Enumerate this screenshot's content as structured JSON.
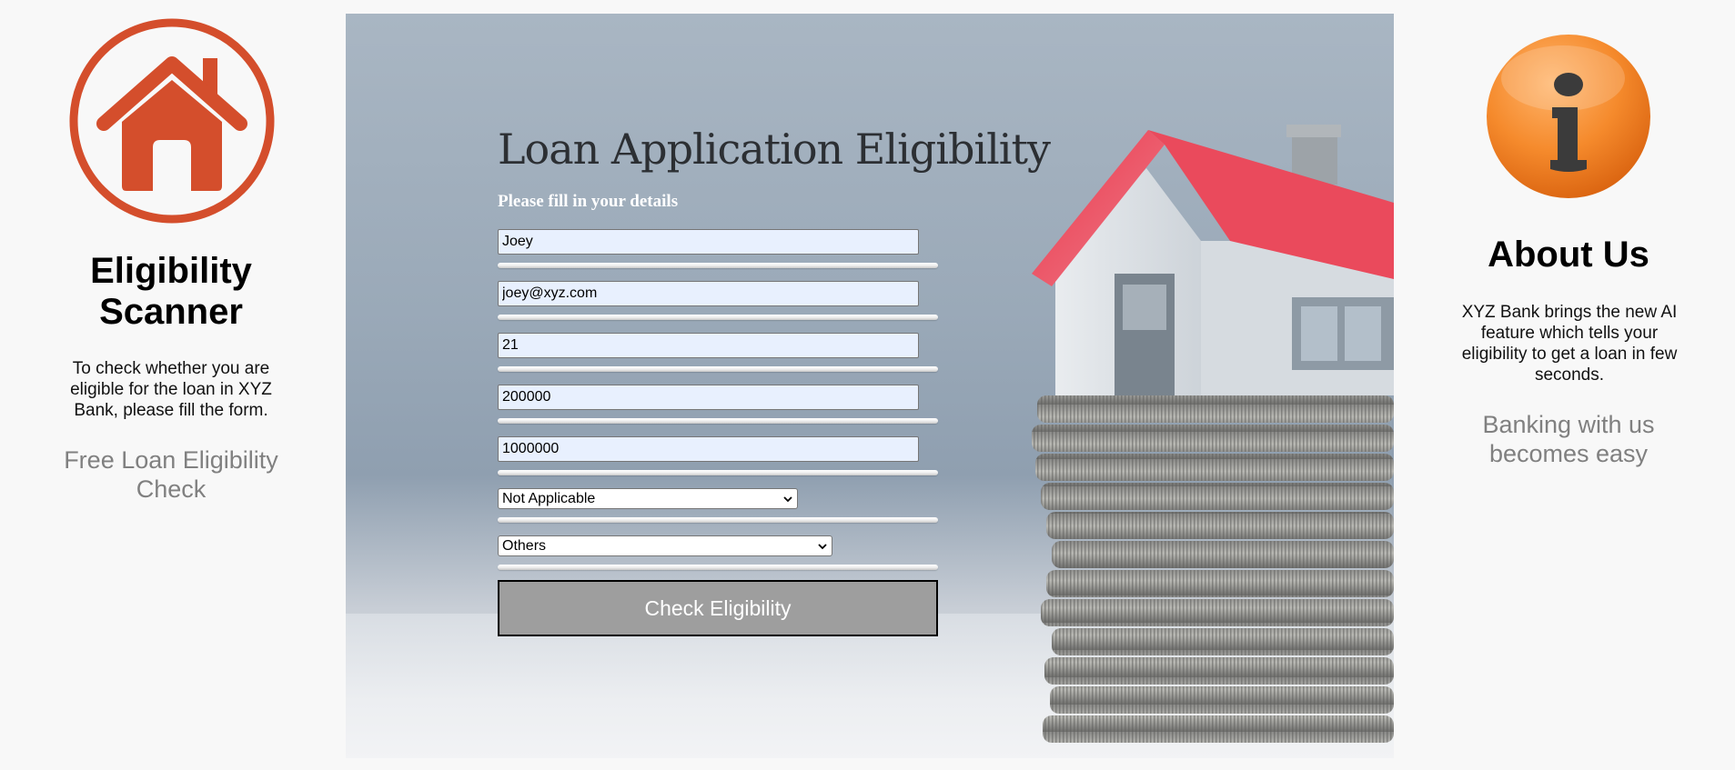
{
  "left": {
    "title": "Eligibility Scanner",
    "description": "To check whether you are eligible for the loan in XYZ Bank, please fill the form.",
    "tagline": "Free Loan Eligibility Check",
    "logo_icon": "house-icon",
    "logo_color": "#d44e2c"
  },
  "right": {
    "title": "About Us",
    "description": "XYZ Bank brings the new AI feature which tells your eligibility to get a loan in few seconds.",
    "tagline": "Banking with us becomes easy",
    "logo_icon": "info-icon",
    "logo_color": "#f07c1e"
  },
  "form": {
    "title": "Loan Application Eligibility",
    "subtitle": "Please fill in your details",
    "fields": [
      {
        "value": "Joey"
      },
      {
        "value": "joey@xyz.com"
      },
      {
        "value": "21"
      },
      {
        "value": "200000"
      },
      {
        "value": "1000000"
      }
    ],
    "marital_select": "Not Applicable",
    "purpose_select": "Others",
    "submit_label": "Check Eligibility"
  },
  "colors": {
    "button": "#9e9e9e",
    "input_bg": "#e8f0fe",
    "roof": "#e03a4e"
  }
}
